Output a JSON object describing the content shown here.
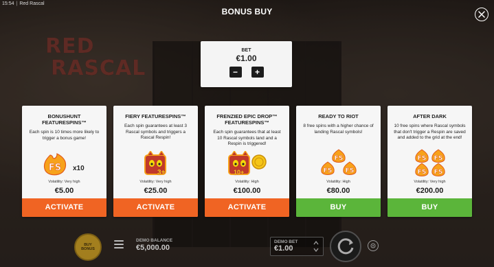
{
  "titlebar": {
    "time": "15:54",
    "app_name": "Red Rascal"
  },
  "background": {
    "logo_line1": "RED",
    "logo_line2": "RASCAL"
  },
  "modal": {
    "title": "BONUS BUY"
  },
  "bet": {
    "label": "BET",
    "value": "€1.00",
    "decrease": "−",
    "increase": "+"
  },
  "cards": [
    {
      "title": "BONUSHUNT FEATURESPINS™",
      "description": "Each spin is 10 times more likely to trigger a bonus game!",
      "icon": "fs-x10-icon",
      "volatility": "Volatility: Very high",
      "price": "€5.00",
      "button": "ACTIVATE",
      "button_color": "#f06423"
    },
    {
      "title": "FIERY FEATURESPINS™",
      "description": "Each spin guarantees at least 3 Rascal symbols and triggers a Rascal Respin!",
      "icon": "rascal-3-plus-icon",
      "volatility": "Volatility: Very high",
      "price": "€25.00",
      "button": "ACTIVATE",
      "button_color": "#f06423"
    },
    {
      "title": "FRENZIED EPIC DROP™ FEATURESPINS™",
      "description": "Each spin guarantees that at least 10 Rascal symbols land and a Respin is triggered!",
      "icon": "rascal-10-plus-icon",
      "volatility": "Volatility: High",
      "price": "€100.00",
      "button": "ACTIVATE",
      "button_color": "#f06423"
    },
    {
      "title": "READY TO RIOT",
      "description": "8 free spins with a higher chance of landing Rascal symbols!",
      "icon": "fs-triple-icon",
      "volatility": "Volatility: High",
      "price": "€80.00",
      "button": "BUY",
      "button_color": "#5bb53a"
    },
    {
      "title": "AFTER DARK",
      "description": "10 free spins where Rascal symbols that don't trigger a Respin are saved and added to the grid at the end!",
      "icon": "fs-quad-icon",
      "volatility": "Volatility: Very high",
      "price": "€200.00",
      "button": "BUY",
      "button_color": "#5bb53a"
    }
  ],
  "icon_labels": {
    "x10": "x10",
    "three_plus": "3+",
    "ten_plus": "10+",
    "fs": "FS"
  },
  "bottom": {
    "bonus_buy_label_1": "BUY",
    "bonus_buy_label_2": "BONUS",
    "demo_balance_label": "DEMO BALANCE",
    "demo_balance_value": "€5,000.00",
    "demo_bet_label": "DEMO BET",
    "demo_bet_value": "€1.00"
  }
}
